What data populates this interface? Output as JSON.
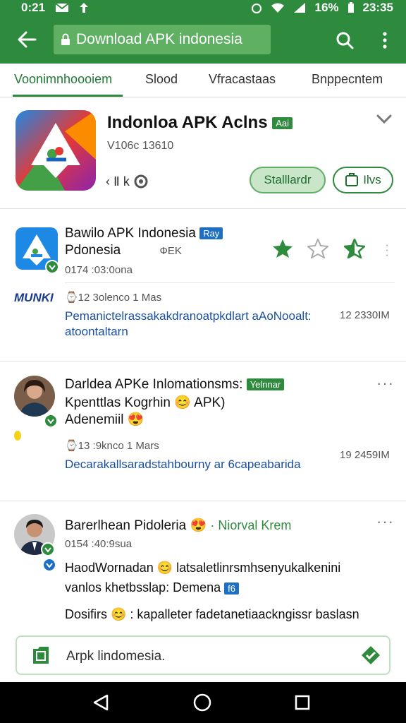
{
  "status_bar": {
    "time_left": "0:21",
    "time_right": "23:35",
    "battery": "16%"
  },
  "app_bar": {
    "url": "Download APK indonesia"
  },
  "tabs": [
    {
      "label": "Voonimnhoooiem"
    },
    {
      "label": "Slood"
    },
    {
      "label": "Vfracastaas"
    },
    {
      "label": "Bnppecntem"
    }
  ],
  "header_card": {
    "title": "Indonloa APK Aclns",
    "title_badge": "Aai",
    "version": "V106c 13610",
    "shares": "‹ Ⅱ k",
    "standard_button": "Stalllardr",
    "live_button": "Ilvs"
  },
  "posts": [
    {
      "title": "Bawilo APK Indonesia",
      "title_badge": "Ray",
      "subtitle": "Pdonesia",
      "subtitle_extra": "ФEK",
      "meta": "0174 :03:0ona",
      "logo_text": "MUNKI",
      "stats": "⌚12 3olenco 1 Mas",
      "link_line1": "Pemanictelrassakakdranoatpkdlart aAoNooalt:",
      "link_line2": "atoontaltarn",
      "time": "12 2330IM"
    },
    {
      "title": "Darldea APKe Inlomationsms:",
      "title_badge": "Yelnnar",
      "line2": "Kpenttlas Kogrhin 😊 APK)",
      "line3": "Adenemiil 😍",
      "stats": "⌚13 :9knco 1 Mars",
      "link": "Decarakallsaradstаhbourny ar 6capeabarida",
      "time": "19 2459IM"
    },
    {
      "title": "Barerlhean Pidoleria 😍",
      "title_extra": "· Niorval Krem",
      "meta": "0154 :40:9sua",
      "line2": "HaodWornadan 😊 latsaletlinrsmhsenyukalkenini",
      "line3": "vanlos khetbsslap: Demena",
      "line3_badge": "f6",
      "line4": "Dosifirs 😊 : kapalleter fadetanetiaackngissr baslasn"
    }
  ],
  "input": {
    "value": "Arpk lindomesia."
  },
  "colors": {
    "brand_green": "#2e8b3e",
    "link_blue": "#1a4fa0",
    "accent_blue": "#1e6fc4"
  },
  "icons": [
    "back-arrow-icon",
    "lock-icon",
    "search-icon",
    "more-vert-icon",
    "chevron-down-icon",
    "star-filled-icon",
    "star-outline-icon",
    "star-half-icon",
    "clock-icon",
    "save-icon",
    "check-shield-icon",
    "nav-back-icon",
    "nav-home-icon",
    "nav-recents-icon"
  ]
}
